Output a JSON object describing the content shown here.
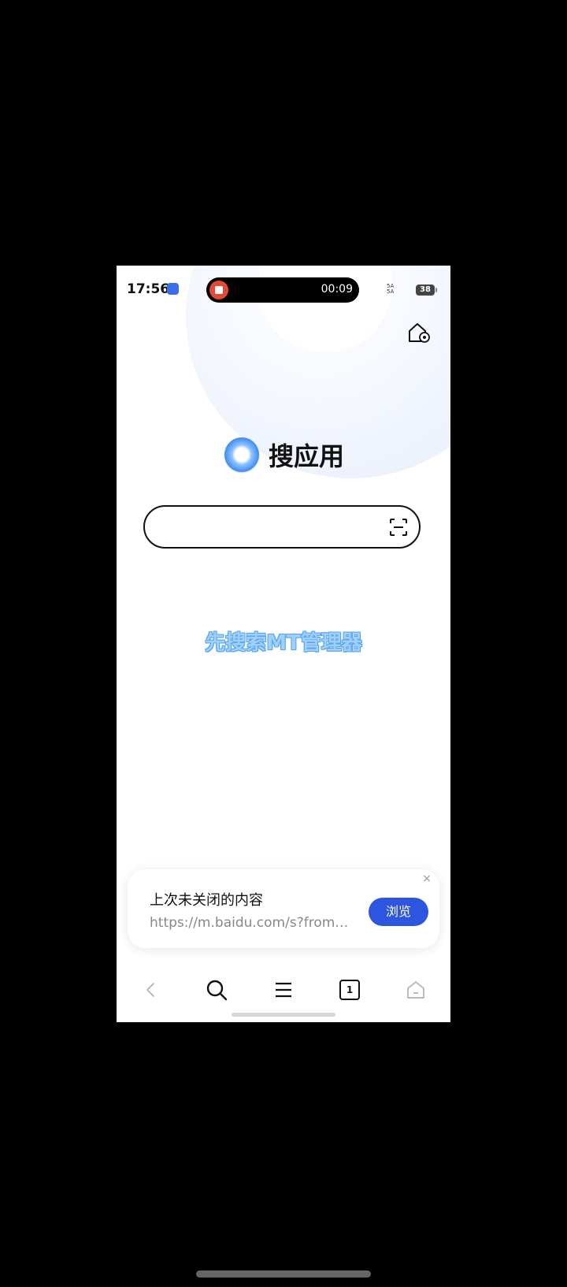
{
  "status_bar": {
    "time": "17:56",
    "recording_time": "00:09",
    "signal_text_1": "5A",
    "signal_text_2": "5A",
    "battery": "38"
  },
  "header": {
    "settings_icon": "home-settings-icon"
  },
  "logo": {
    "text": "搜应用",
    "icon": "search-app-logo-icon"
  },
  "search": {
    "value": "",
    "placeholder": "",
    "scan_icon": "scan-icon"
  },
  "caption": {
    "text": "先搜索MT管理器"
  },
  "resume_card": {
    "title": "上次未关闭的内容",
    "url": "https://m.baidu.com/s?from=…",
    "button_label": "浏览",
    "close_label": "×"
  },
  "bottom_nav": {
    "items": [
      {
        "icon": "back-icon"
      },
      {
        "icon": "search-icon"
      },
      {
        "icon": "menu-icon"
      },
      {
        "icon": "tabs-icon",
        "count": "1"
      },
      {
        "icon": "home-icon"
      }
    ]
  }
}
